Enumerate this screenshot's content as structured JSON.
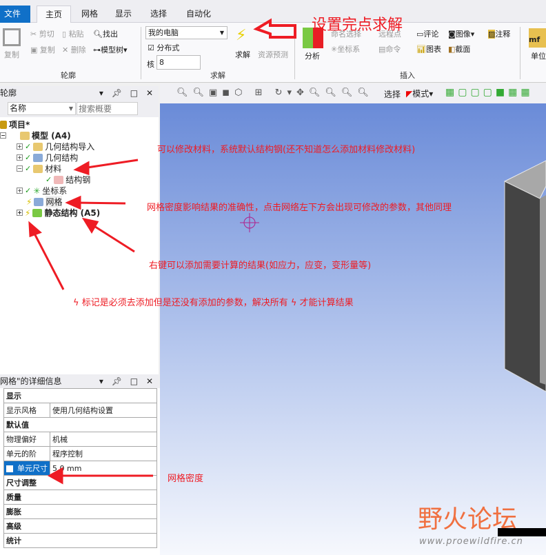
{
  "tabs": {
    "file": "文件",
    "items": [
      "主页",
      "网格",
      "显示",
      "选择",
      "自动化"
    ]
  },
  "ribbon": {
    "outline": {
      "copy_big": "复制",
      "cut": "剪切",
      "paste": "粘贴",
      "find": "找出",
      "copy": "复制",
      "delete": "删除",
      "tree": "模型树",
      "group": "轮廓"
    },
    "solve": {
      "machine": "我的电脑",
      "distributed": "分布式",
      "cores_label": "核",
      "cores": "8",
      "solve": "求解",
      "predict": "资源预测",
      "group": "求解"
    },
    "insert": {
      "analysis": "分析",
      "named_sel": "命名选择",
      "remote_point": "远程点",
      "comment": "评论",
      "image": "图像",
      "annotation": "注释",
      "coord": "坐标系",
      "command": "命令",
      "chart": "图表",
      "section": "截面",
      "group": "插入"
    },
    "units": "单位"
  },
  "outline": {
    "title": "轮廓",
    "filter": "名称",
    "search_placeholder": "搜索概要",
    "tree": {
      "project": "项目*",
      "model": "模型 (A4)",
      "geom_import": "几何结构导入",
      "geometry": "几何结构",
      "materials": "材料",
      "steel": "结构钢",
      "coord": "坐标系",
      "mesh": "网格",
      "static": "静态结构 (A5)"
    }
  },
  "details": {
    "title": "网格\"的详细信息",
    "rows": [
      {
        "k": "显示"
      },
      {
        "k": "显示风格",
        "v": "使用几何结构设置"
      },
      {
        "k": "默认值"
      },
      {
        "k": "物理偏好",
        "v": "机械"
      },
      {
        "k": "单元的阶",
        "v": "程序控制"
      },
      {
        "k": "单元尺寸",
        "v": "5.0 mm"
      },
      {
        "k": "尺寸调整"
      },
      {
        "k": "质量"
      },
      {
        "k": "膨胀"
      },
      {
        "k": "高级"
      },
      {
        "k": "统计"
      }
    ]
  },
  "viewtoolbar": {
    "select": "选择",
    "mode": "模式"
  },
  "annotations": {
    "solve": "设置完点求解",
    "material": "可以修改材料，系统默认结构钢(还不知道怎么添加材料修改材料)",
    "mesh": "网格密度影响结果的准确性，点击网络左下方会出现可修改的参数，其他同理",
    "static": "右键可以添加需要计算的结果(如应力，应变，变形量等)",
    "lightning_a": "标记是必须去添加但是还没有添加的参数，解决所有",
    "lightning_b": "才能计算结果",
    "density": "网格密度"
  },
  "watermark": {
    "name": "野火论坛",
    "url": "www.proewildfire.cn"
  },
  "colors": {
    "accent": "#1070c8",
    "annotation": "#ee1c24"
  }
}
